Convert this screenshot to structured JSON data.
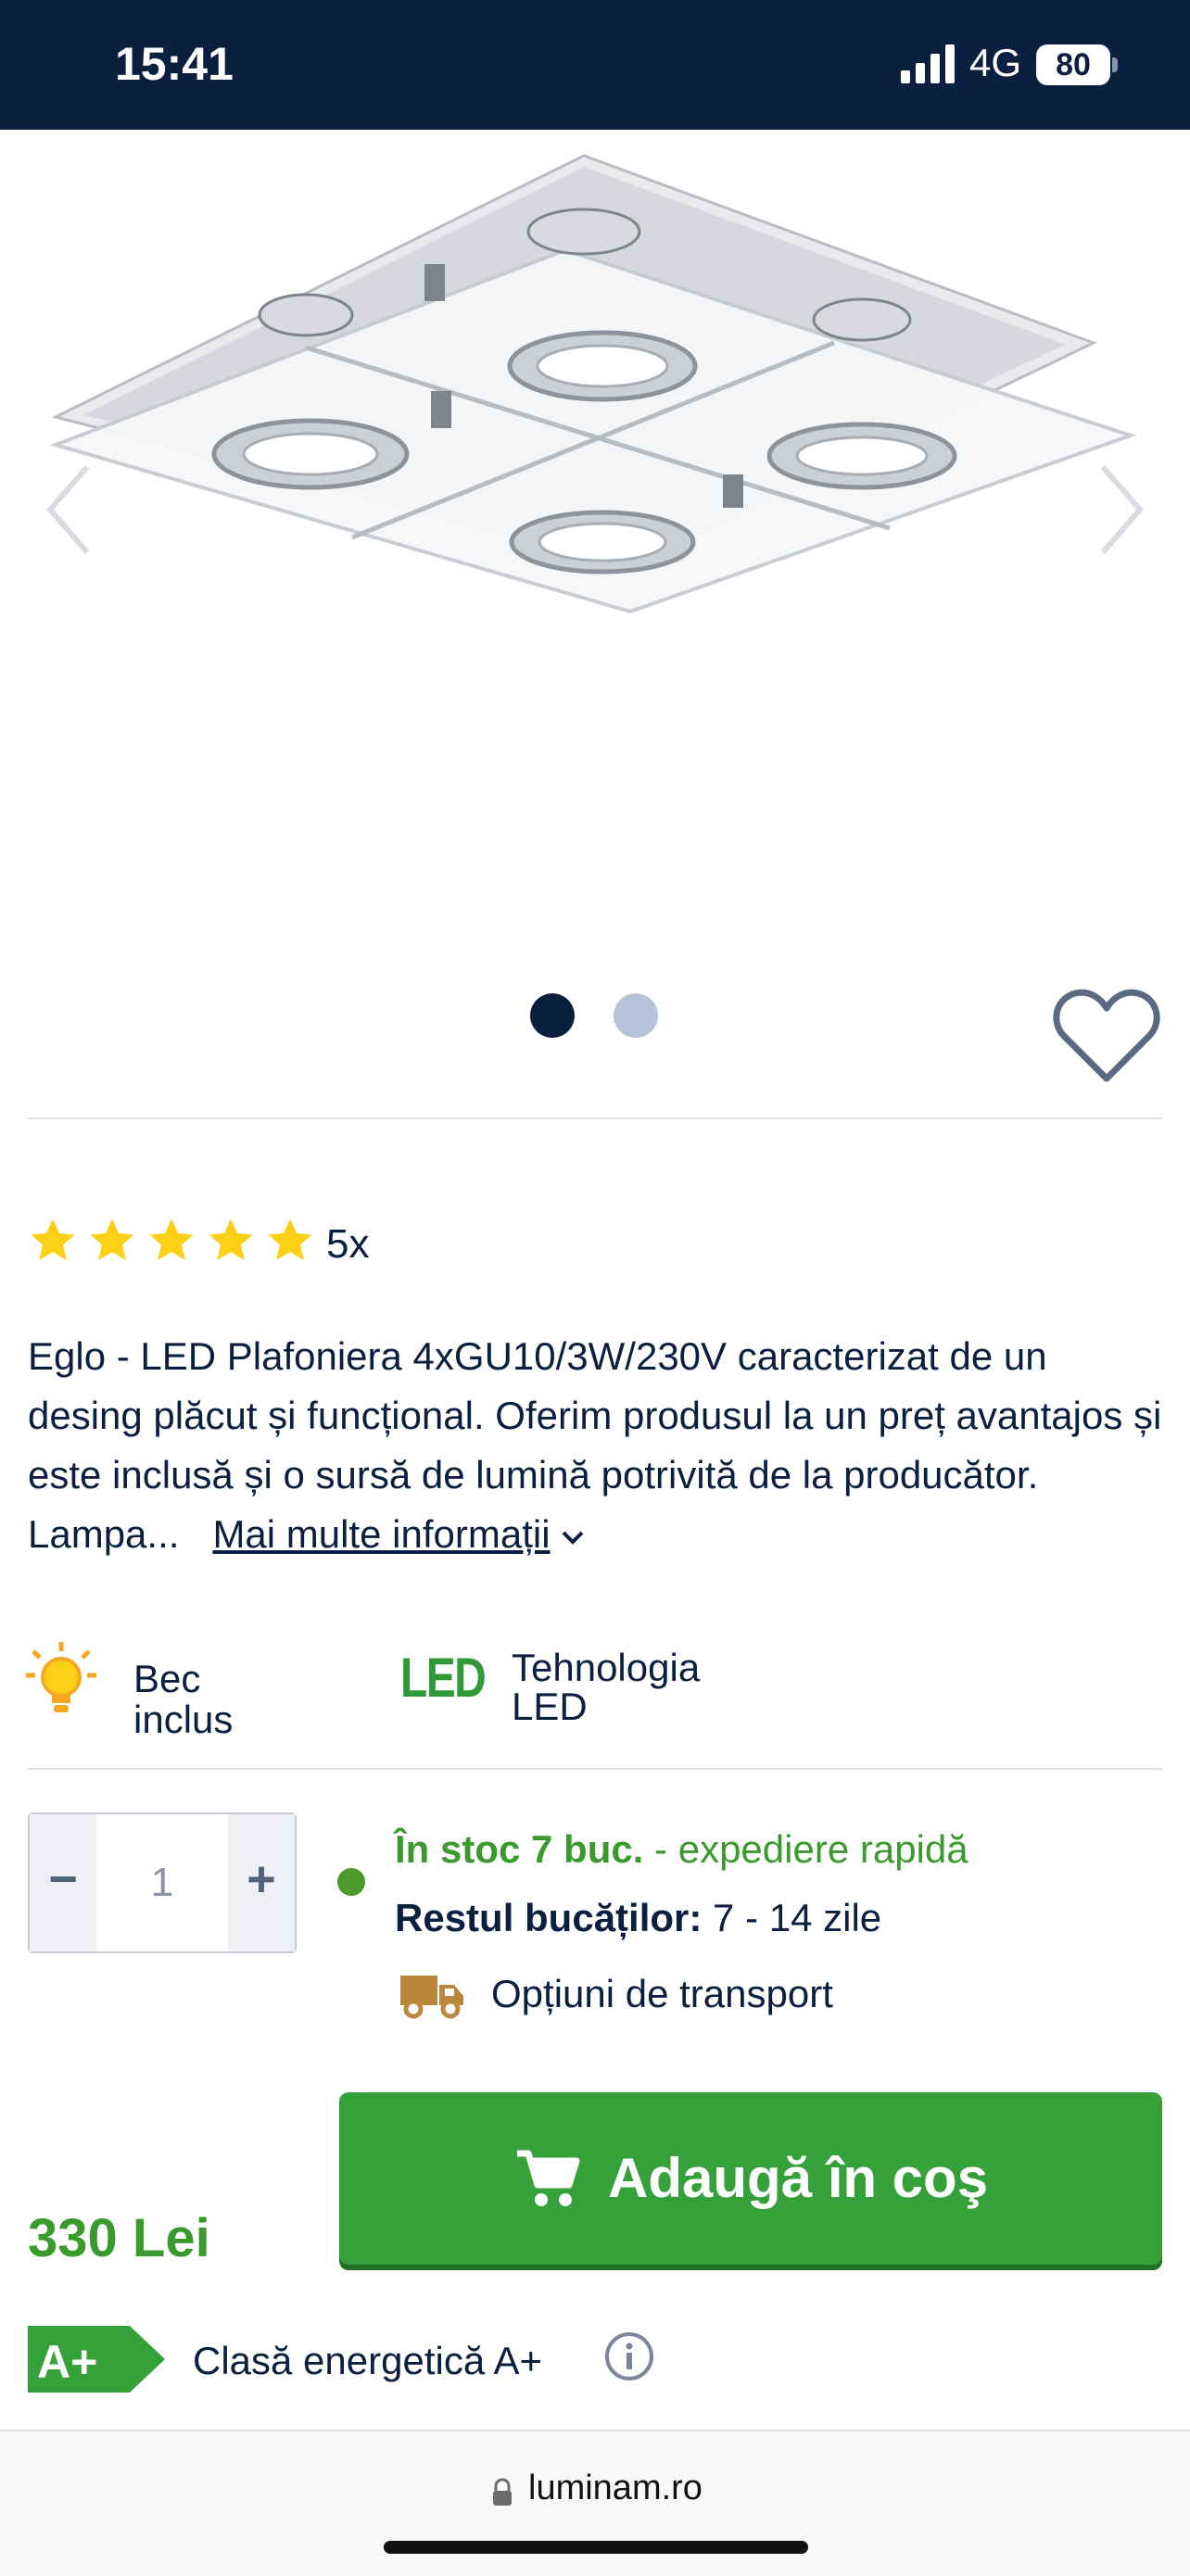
{
  "status_bar": {
    "time": "15:41",
    "network": "4G",
    "battery": "80"
  },
  "gallery": {
    "dots_total": 2,
    "active_index": 0,
    "colors": {
      "dot_active": "#0b1f3f",
      "dot_inactive": "#b6c2d8"
    }
  },
  "rating": {
    "stars": 5,
    "count": "5x",
    "star_color": "#fdd017"
  },
  "description": {
    "text": "Eglo - LED Plafoniera 4xGU10/3W/230V caracterizat de un desing plăcut și funcțional. Oferim produsul la un preț avantajos și este inclusă și o sursă de lumină potrivită de la producător.  Lampa...",
    "more_link": "Mai multe informații"
  },
  "features": [
    {
      "icon": "bulb-icon",
      "label": "Bec inclus"
    },
    {
      "icon": "led-icon",
      "label_line1": "Tehnologia",
      "label_line2": "LED",
      "icon_text": "LED"
    }
  ],
  "quantity": {
    "value": "1",
    "minus": "−",
    "plus": "+"
  },
  "availability": {
    "stock_bold": "În stoc 7 buc.",
    "stock_rest": " - expediere rapidă",
    "rest_label": "Restul bucăților:",
    "rest_value": " 7 - 14 zile",
    "shipping_link": "Opțiuni de transport"
  },
  "price": "330 Lei",
  "cart_button": {
    "label": "Adaugă în coş",
    "color": "#36a13b"
  },
  "energy": {
    "badge": "A+",
    "label": "Clasă energetică A+"
  },
  "browser": {
    "url": "luminam.ro"
  }
}
